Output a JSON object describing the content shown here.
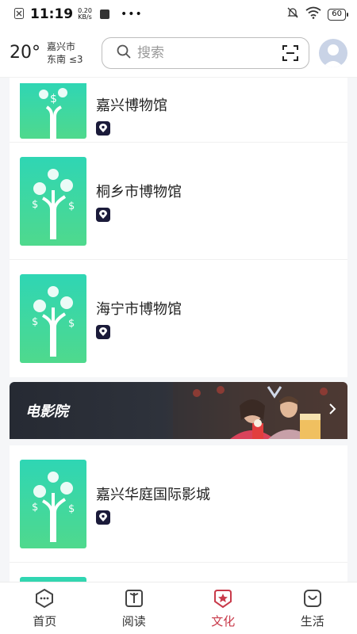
{
  "status_bar": {
    "time": "11:19",
    "net_speed": "0.20",
    "net_unit": "KB/s",
    "battery": "60"
  },
  "header": {
    "temperature": "20°",
    "city": "嘉兴市",
    "wind": "东南 ≤3",
    "search_placeholder": "搜索"
  },
  "venues_top": [
    {
      "name": "嘉兴博物馆"
    },
    {
      "name": "桐乡市博物馆"
    },
    {
      "name": "海宁市博物馆"
    }
  ],
  "cinema_section": {
    "title": "电影院"
  },
  "cinemas": [
    {
      "name": "嘉兴华庭国际影城"
    }
  ],
  "nav": {
    "items": [
      {
        "label": "首页",
        "icon": "home-icon"
      },
      {
        "label": "阅读",
        "icon": "book-icon"
      },
      {
        "label": "文化",
        "icon": "culture-star-icon"
      },
      {
        "label": "生活",
        "icon": "bag-icon"
      }
    ],
    "active_index": 2,
    "active_color": "#c83a4a"
  },
  "colors": {
    "thumb_gradient_top": "#2fd6b4",
    "thumb_gradient_bottom": "#4fd98d"
  }
}
